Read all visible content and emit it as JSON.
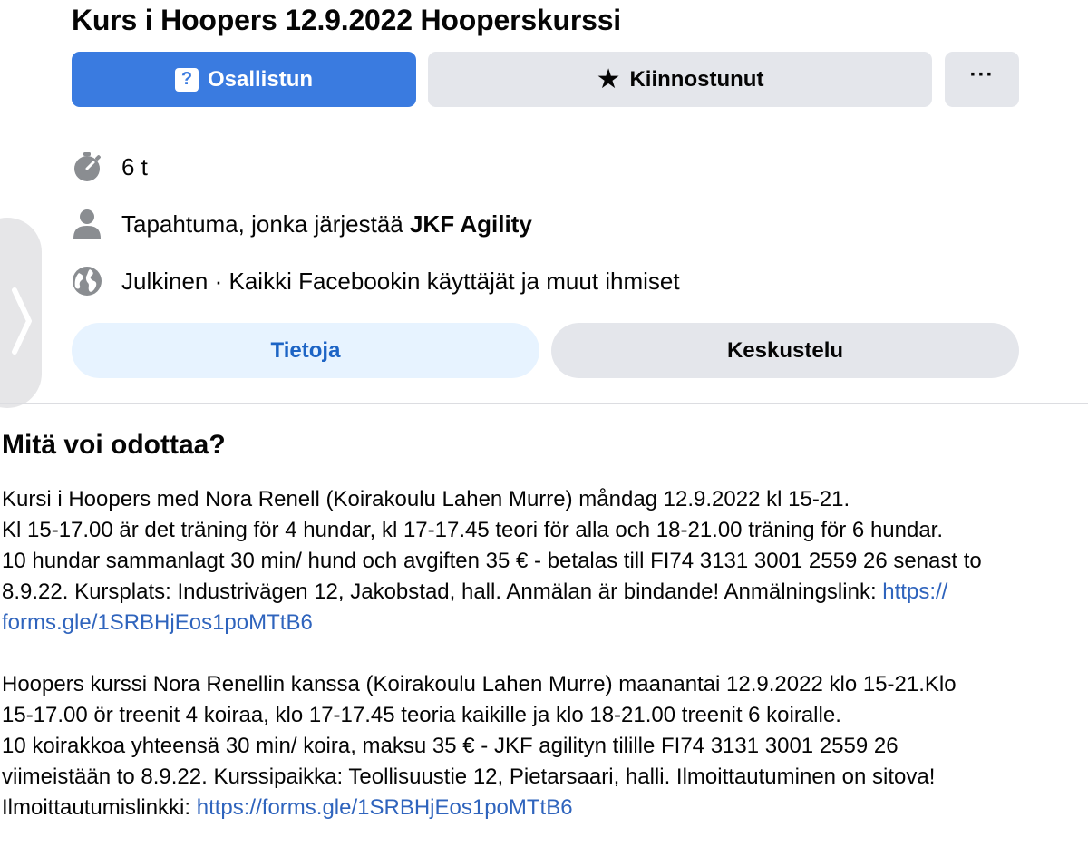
{
  "event": {
    "title": "Kurs i Hoopers 12.9.2022 Hooperskurssi"
  },
  "actions": {
    "going_label": "Osallistun",
    "interested_label": "Kiinnostunut",
    "more_label": "···"
  },
  "details": {
    "duration": "6 t",
    "host_prefix": "Tapahtuma, jonka järjestää ",
    "host_name": "JKF Agility",
    "privacy": "Julkinen · Kaikki Facebookin käyttäjät ja muut ihmiset"
  },
  "tabs": {
    "about": "Tietoja",
    "discussion": "Keskustelu"
  },
  "description": {
    "heading": "Mitä voi odottaa?",
    "swedish": {
      "line1": "Kursi i Hoopers med Nora Renell (Koirakoulu Lahen Murre) måndag 12.9.2022 kl 15-21.",
      "line2": "Kl 15-17.00 är det träning för 4 hundar, kl 17-17.45 teori för alla och 18-21.00 träning för 6 hundar.",
      "line3": "10 hundar sammanlagt 30 min/ hund och avgiften 35 € - betalas till FI74 3131 3001 2559 26 senast to",
      "line4_text": "8.9.22. Kursplats: Industrivägen 12, Jakobstad, hall. Anmälan är bindande! Anmälningslink: ",
      "line4_link": "https://",
      "line5_link": "forms.gle/1SRBHjEos1poMTtB6"
    },
    "finnish": {
      "line1": "Hoopers kurssi Nora Renellin kanssa (Koirakoulu Lahen Murre) maanantai 12.9.2022 klo 15-21.Klo",
      "line2": "15-17.00 ör treenit 4 koiraa, klo 17-17.45 teoria kaikille ja klo 18-21.00 treenit 6 koiralle.",
      "line3": "10 koirakkoa yhteensä 30 min/ koira, maksu 35 € - JKF agilityn tilille FI74 3131 3001 2559 26",
      "line4": "viimeistään to 8.9.22. Kurssipaikka: Teollisuustie 12, Pietarsaari, halli. Ilmoittautuminen on sitova!",
      "line5_text": "Ilmoittautumislinkki: ",
      "line5_link": "https://forms.gle/1SRBHjEos1poMTtB6"
    }
  },
  "colors": {
    "primary": "#3a7be0",
    "secondary_bg": "#e4e6eb",
    "tab_active_bg": "#e7f3ff",
    "tab_active_text": "#1d64c5",
    "link": "#2f64bd",
    "icon_gray": "#8a8d91"
  },
  "icons": {
    "going": "question-ticket-icon",
    "interested": "star-icon",
    "more": "more-dots-icon",
    "duration": "stopwatch-icon",
    "host": "person-icon",
    "privacy": "globe-icon",
    "side": "chevron-right-icon"
  }
}
